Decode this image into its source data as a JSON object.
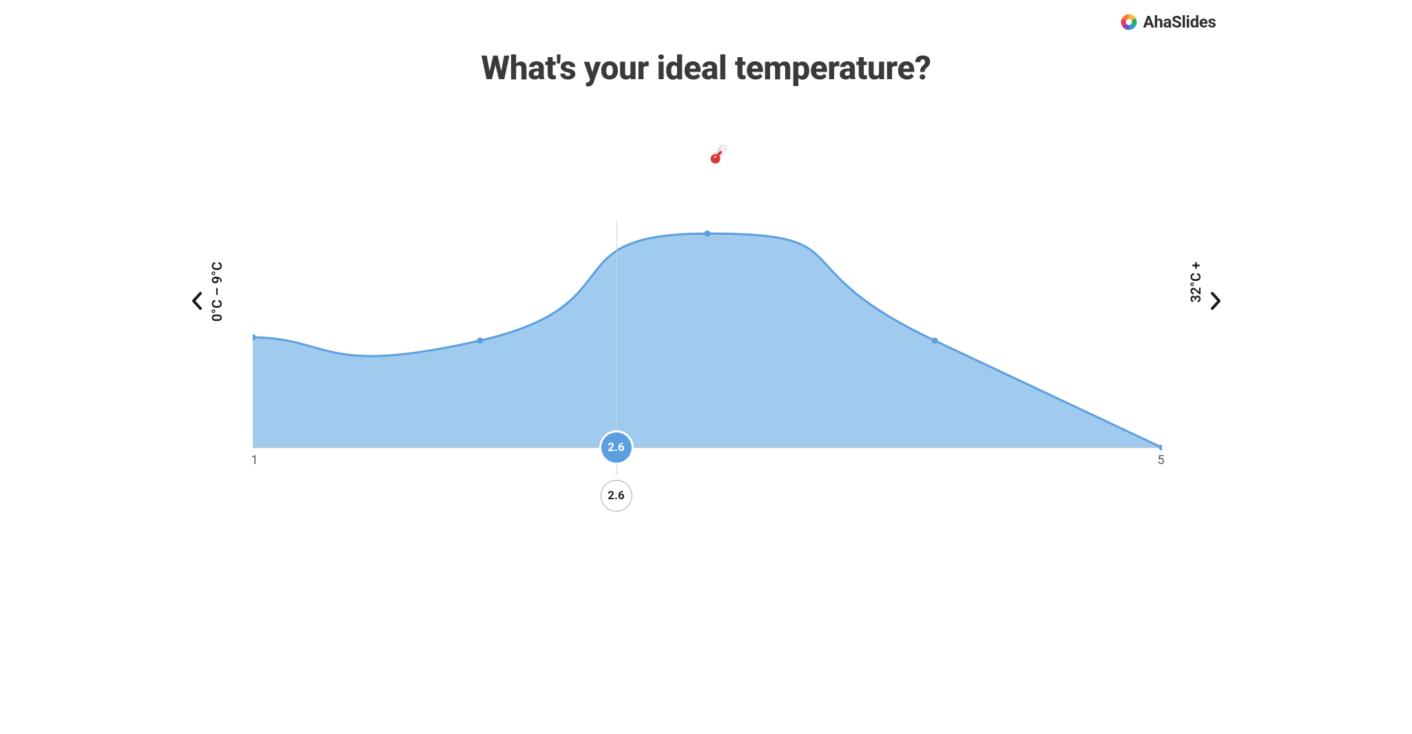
{
  "brand": {
    "name": "AhaSlides"
  },
  "title": "What's your ideal temperature?",
  "left_label": "0°C – 9°C",
  "right_label": "32°C +",
  "axis": {
    "min_label": "1",
    "max_label": "5"
  },
  "average": {
    "blue": "2.6",
    "white": "2.6",
    "value": 2.6
  },
  "chart_data": {
    "type": "area",
    "title": "What's your ideal temperature?",
    "xlabel": "",
    "ylabel": "",
    "xlim": [
      1,
      5
    ],
    "ylim": [
      0,
      350
    ],
    "x": [
      1,
      2,
      3,
      4,
      5
    ],
    "values": [
      165,
      160,
      320,
      160,
      0
    ],
    "average": 2.6,
    "annotations": [
      "2.6",
      "2.6"
    ],
    "legend": [],
    "left_end_label": "0°C – 9°C",
    "right_end_label": "32°C +",
    "fill_color": "#96c4ec",
    "stroke_color": "#5b9fe0"
  }
}
